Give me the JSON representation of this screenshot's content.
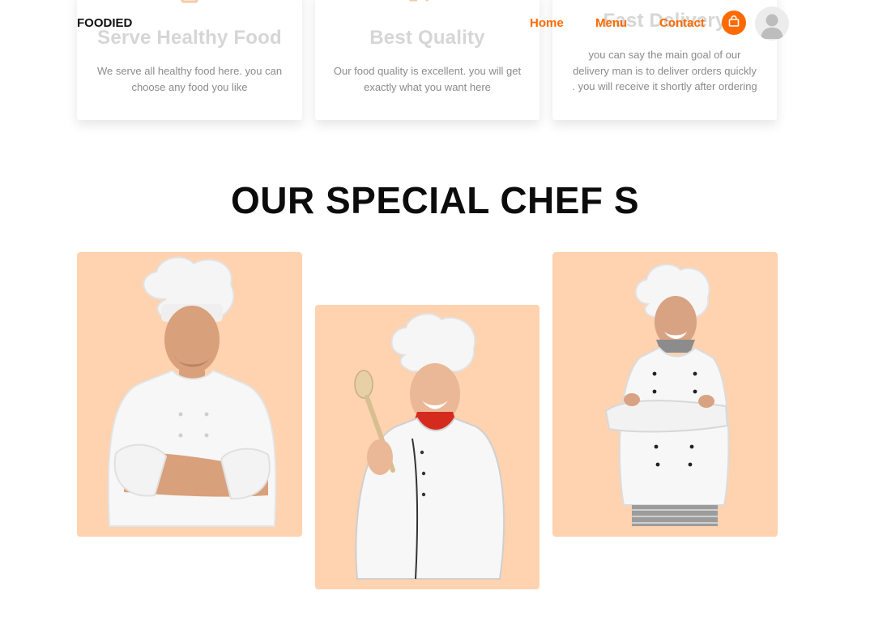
{
  "header": {
    "brand": "FOODIED",
    "nav": [
      {
        "label": "Home"
      },
      {
        "label": "Menu"
      },
      {
        "label": "Contact"
      }
    ],
    "cart_icon": "shopping-bag-icon",
    "avatar_icon": "user-avatar-icon"
  },
  "features": [
    {
      "title": "Serve Healthy Food",
      "description": "We serve all healthy food here. you can choose any food you like",
      "icon": "healthy-food-icon"
    },
    {
      "title": "Best Quality",
      "description": "Our food quality is excellent. you will get exactly what you want here",
      "icon": "quality-badge-icon"
    },
    {
      "title": "Fast Delivery",
      "description": "you can say the main goal of our delivery man is to deliver orders quickly . you will receive it shortly after ordering",
      "icon": "delivery-icon"
    }
  ],
  "chefs_section": {
    "title": "OUR SPECIAL CHEF S"
  },
  "colors": {
    "accent": "#ff6a00",
    "chef_card_bg": "#ffd2b0",
    "feature_title": "#d6d6d6",
    "feature_desc": "#8b8b8b"
  }
}
